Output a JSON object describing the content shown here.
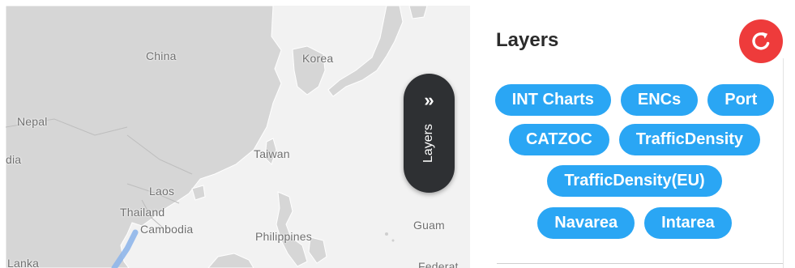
{
  "map": {
    "labels": {
      "china": "China",
      "korea": "Korea",
      "nepal": "Nepal",
      "india": "dia",
      "taiwan": "Taiwan",
      "laos": "Laos",
      "thailand": "Thailand",
      "cambodia": "Cambodia",
      "philippines": "Philippines",
      "guam": "Guam",
      "lanka": "Lanka",
      "federated": "Federat"
    }
  },
  "layers_toggle": {
    "chevron": "»",
    "label": "Layers"
  },
  "panel": {
    "title": "Layers",
    "reset_icon": "refresh-icon",
    "layers": [
      [
        "INT Charts",
        "ENCs",
        "Port"
      ],
      [
        "CATZOC",
        "TrafficDensity"
      ],
      [
        "TrafficDensity(EU)"
      ],
      [
        "Navarea",
        "Intarea"
      ]
    ]
  },
  "colors": {
    "chip": "#2aa6f4",
    "reset_button": "#ee3b3b",
    "toggle": "#2e3033",
    "land": "#d6d6d6",
    "sea": "#f2f2f2"
  }
}
